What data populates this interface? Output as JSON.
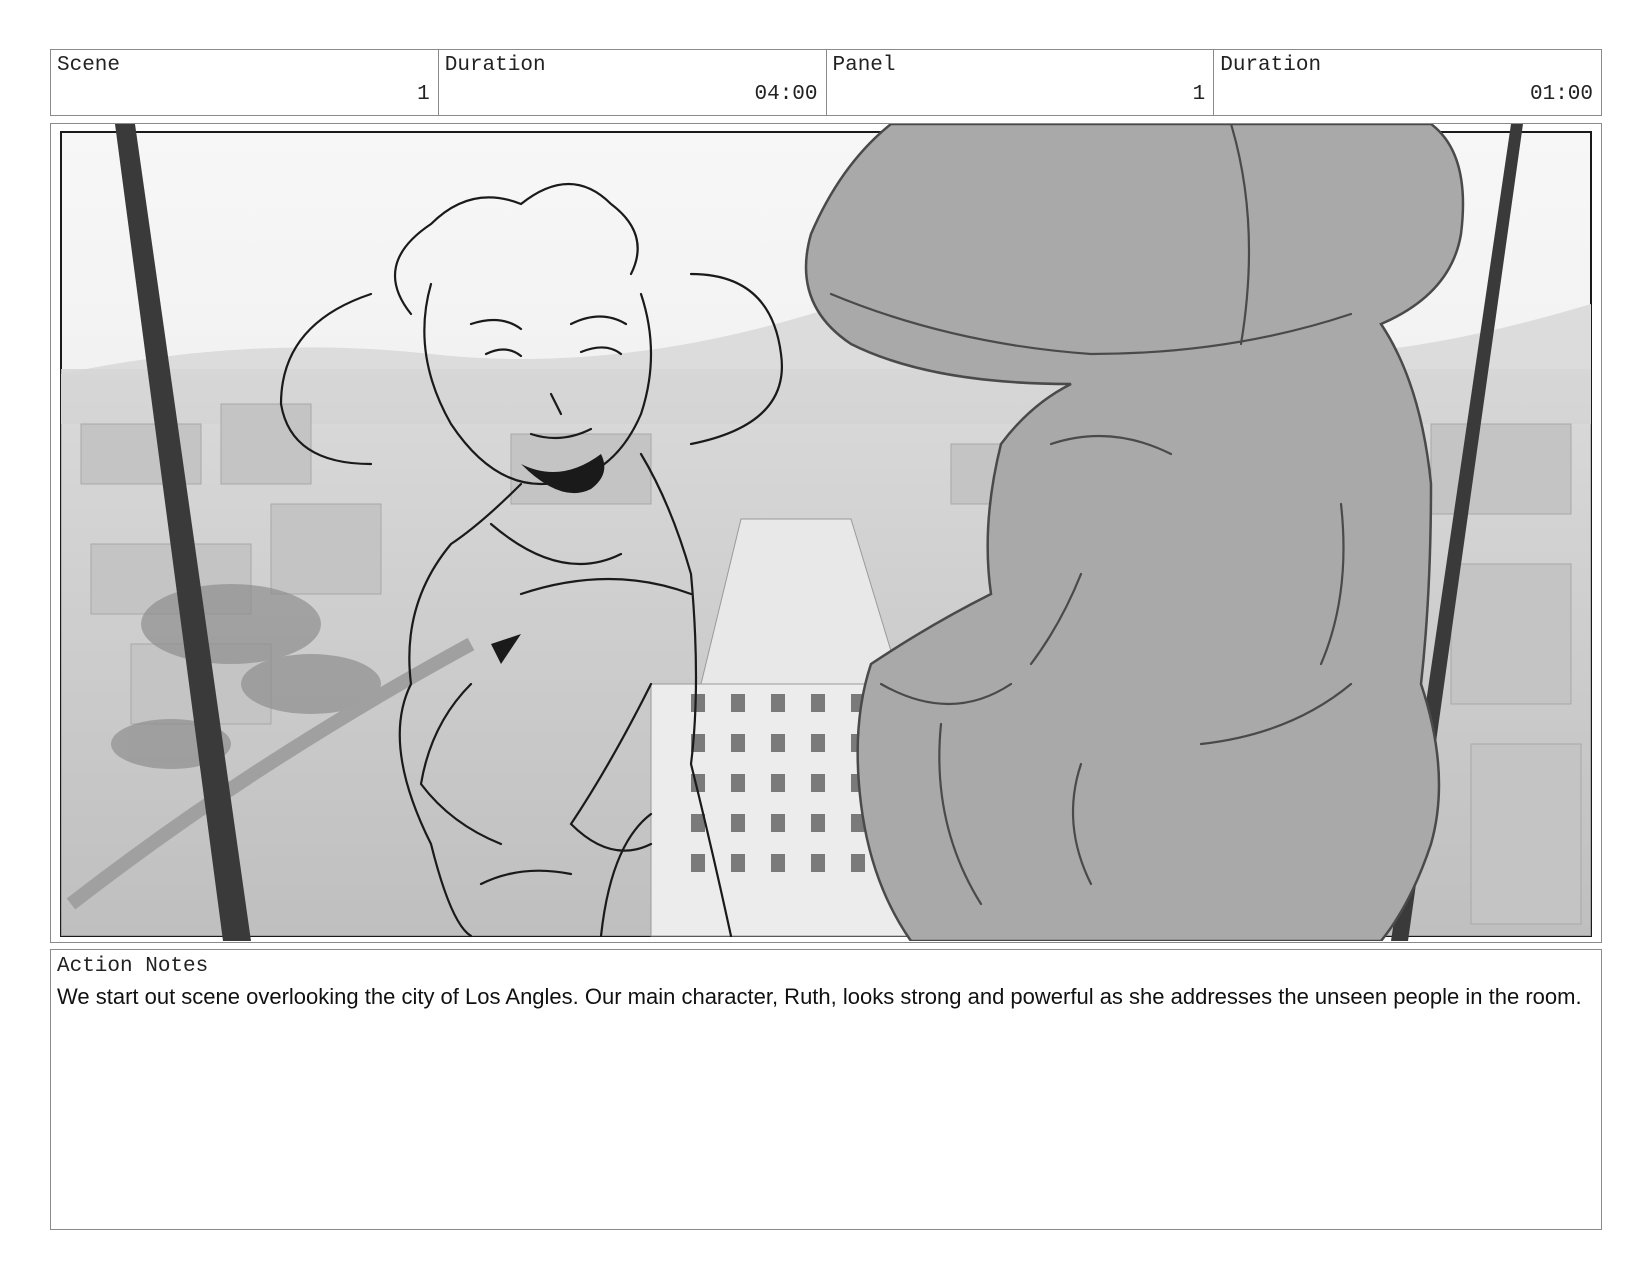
{
  "header": {
    "scene_label": "Scene",
    "scene_value": "1",
    "scene_duration_label": "Duration",
    "scene_duration_value": "04:00",
    "panel_label": "Panel",
    "panel_value": "1",
    "panel_duration_label": "Duration",
    "panel_duration_value": "01:00"
  },
  "notes": {
    "title": "Action Notes",
    "text": "We start out scene overlooking the city of Los Angles. Our main character, Ruth, looks strong and powerful as she addresses the unseen people in the room."
  },
  "colors": {
    "border": "#8a8a8a",
    "sketch_line": "#1a1a1a",
    "foreground_fill": "#a9a9a9",
    "window_frame": "#3a3a3a"
  }
}
